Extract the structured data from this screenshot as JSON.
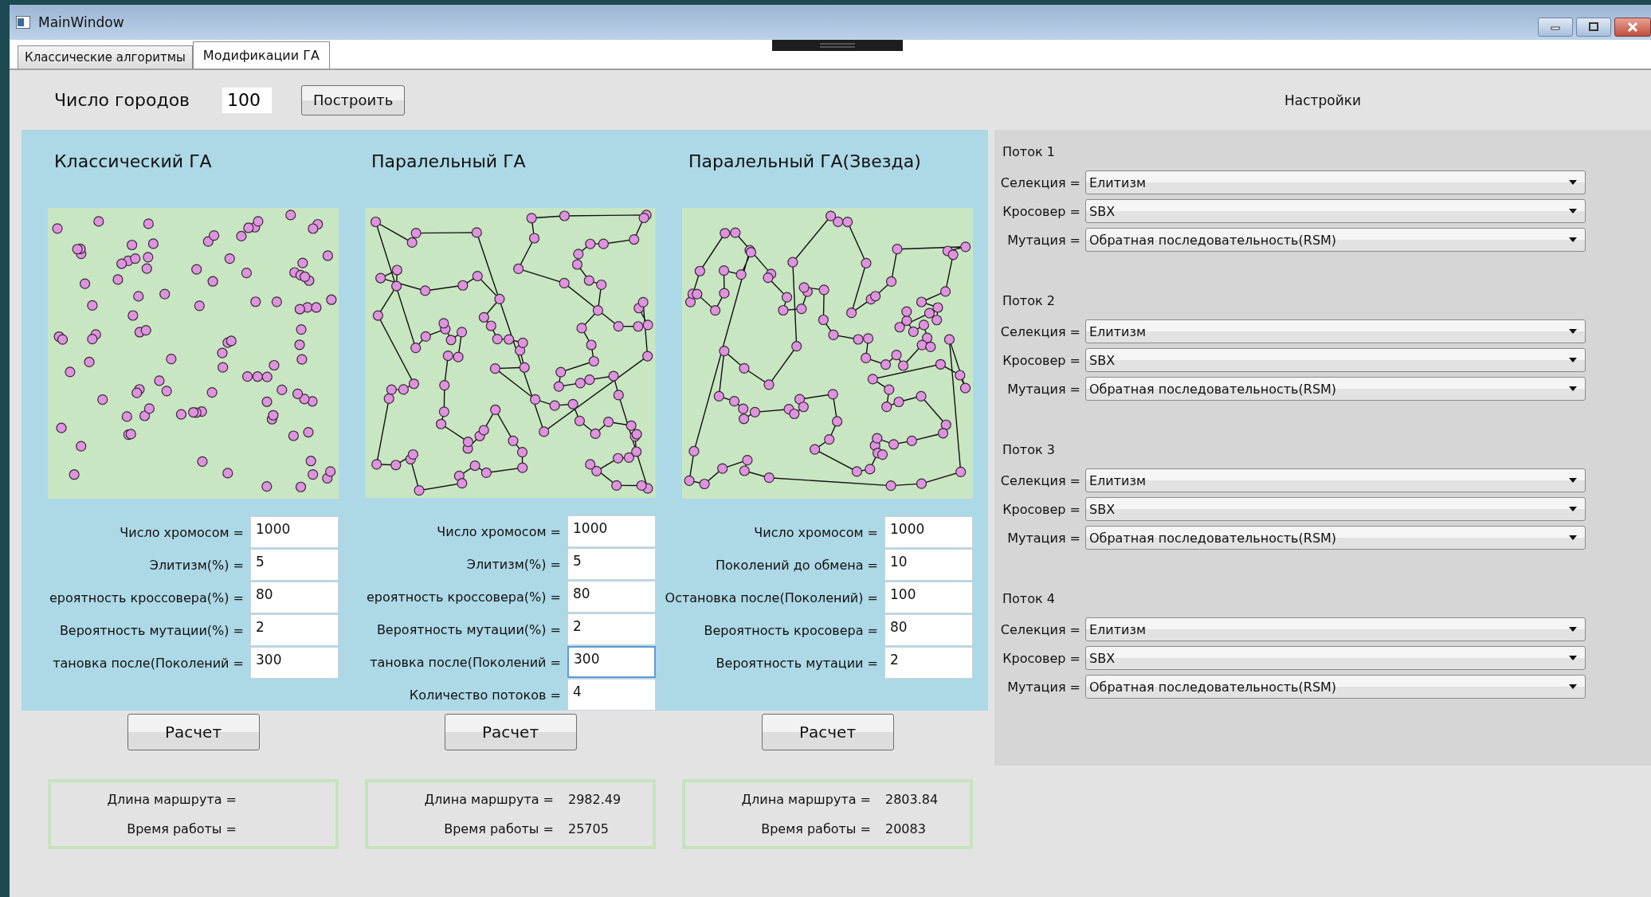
{
  "window": {
    "title": "MainWindow"
  },
  "tabs": [
    {
      "label": "Классические алгоритмы",
      "selected": false
    },
    {
      "label": "Модификации ГА",
      "selected": true
    }
  ],
  "cities": {
    "label": "Число городов",
    "value": "100",
    "button": "Построить"
  },
  "settings_title": "Настройки",
  "algorithms": [
    {
      "title": "Классический ГА",
      "route": false,
      "fields": [
        {
          "label": "Число хромосом =",
          "value": "1000",
          "focused": false
        },
        {
          "label": "Элитизм(%) =",
          "value": "5",
          "focused": false
        },
        {
          "label": "ероятность кроссовера(%) =",
          "value": "80",
          "focused": false
        },
        {
          "label": "Вероятность мутации(%) =",
          "value": "2",
          "focused": false
        },
        {
          "label": "тановка после(Поколений =",
          "value": "300",
          "focused": false
        }
      ],
      "button": "Расчет",
      "results": [
        {
          "label": "Длина маршрута ="
        },
        {
          "label": "Время работы ="
        }
      ]
    },
    {
      "title": "Паралельный ГА",
      "route": true,
      "fields": [
        {
          "label": "Число хромосом =",
          "value": "1000",
          "focused": false
        },
        {
          "label": "Элитизм(%) =",
          "value": "5",
          "focused": false
        },
        {
          "label": "ероятность кроссовера(%) =",
          "value": "80",
          "focused": false
        },
        {
          "label": "Вероятность мутации(%) =",
          "value": "2",
          "focused": false
        },
        {
          "label": "тановка после(Поколений =",
          "value": "300",
          "focused": true
        },
        {
          "label": "Количество потоков =",
          "value": "4",
          "focused": false
        }
      ],
      "button": "Расчет",
      "results": [
        {
          "label": "Длина маршрута =",
          "value": "2982.49"
        },
        {
          "label": "Время работы =",
          "value": "25705"
        }
      ]
    },
    {
      "title": "Паралельный ГА(Звезда)",
      "route": true,
      "fields": [
        {
          "label": "Число хромосом =",
          "value": "1000",
          "focused": false
        },
        {
          "label": "Поколений до обмена =",
          "value": "10",
          "focused": false
        },
        {
          "label": "Остановка после(Поколений) =",
          "value": "100",
          "focused": false
        },
        {
          "label": "Вероятность кросовера =",
          "value": "80",
          "focused": false
        },
        {
          "label": "Вероятность мутации =",
          "value": "2",
          "focused": false
        }
      ],
      "button": "Расчет",
      "results": [
        {
          "label": "Длина маршрута =",
          "value": "2803.84"
        },
        {
          "label": "Время работы =",
          "value": "20083"
        }
      ]
    }
  ],
  "threads": [
    {
      "title": "Поток 1",
      "rows": [
        {
          "label": "Селекция =",
          "value": "Елитизм"
        },
        {
          "label": "Кросовер =",
          "value": "SBX"
        },
        {
          "label": "Мутация =",
          "value": "Обратная последовательность(RSM)"
        }
      ]
    },
    {
      "title": "Поток 2",
      "rows": [
        {
          "label": "Селекция =",
          "value": "Елитизм"
        },
        {
          "label": "Кросовер =",
          "value": "SBX"
        },
        {
          "label": "Мутация =",
          "value": "Обратная последовательность(RSM)"
        }
      ]
    },
    {
      "title": "Поток 3",
      "rows": [
        {
          "label": "Селекция =",
          "value": "Елитизм"
        },
        {
          "label": "Кросовер =",
          "value": "SBX"
        },
        {
          "label": "Мутация =",
          "value": "Обратная последовательность(RSM)"
        }
      ]
    },
    {
      "title": "Поток 4",
      "rows": [
        {
          "label": "Селекция =",
          "value": "Елитизм"
        },
        {
          "label": "Кросовер =",
          "value": "SBX"
        },
        {
          "label": "Мутация =",
          "value": "Обратная последовательность(RSM)"
        }
      ]
    }
  ]
}
